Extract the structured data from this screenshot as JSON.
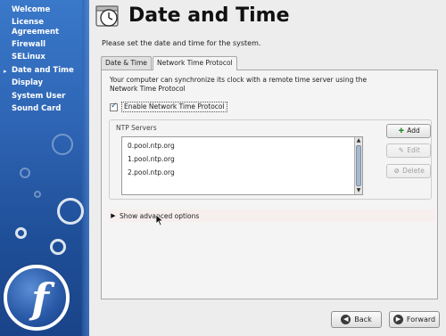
{
  "sidebar": {
    "items": [
      {
        "label": "Welcome"
      },
      {
        "label": "License"
      },
      {
        "label": "Agreement"
      },
      {
        "label": "Firewall"
      },
      {
        "label": "SELinux"
      },
      {
        "label": "Date and Time"
      },
      {
        "label": "Display"
      },
      {
        "label": "System User"
      },
      {
        "label": "Sound Card"
      }
    ],
    "active_marker": "▸",
    "logo_glyph": "f"
  },
  "header": {
    "title": "Date and Time",
    "description": "Please set the date and time for the system.",
    "icon": "clock-calendar-icon"
  },
  "tabs": [
    {
      "label": "Date & Time",
      "active": false
    },
    {
      "label": "Network Time Protocol",
      "active": true
    }
  ],
  "ntp": {
    "description": "Your computer can synchronize its clock with a remote time server using the Network Time Protocol",
    "enable_label": "Enable Network Time Protocol",
    "enabled": true,
    "group_label": "NTP Servers",
    "servers": [
      "0.pool.ntp.org",
      "1.pool.ntp.org",
      "2.pool.ntp.org"
    ],
    "buttons": {
      "add": "Add",
      "edit": "Edit",
      "delete": "Delete"
    },
    "advanced_label": "Show advanced options"
  },
  "footer": {
    "back_label": "Back",
    "forward_label": "Forward"
  },
  "colors": {
    "sidebar": "#2f66b6",
    "background": "#ededed",
    "add_icon": "#2a8a2a"
  }
}
